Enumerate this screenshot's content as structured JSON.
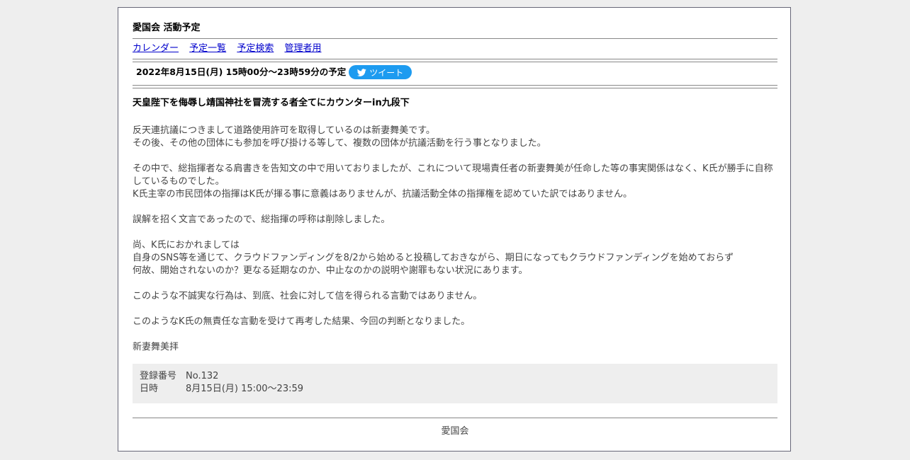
{
  "site": {
    "title": "愛国会 活動予定"
  },
  "nav": {
    "items": [
      "カレンダー",
      "予定一覧",
      "予定検索",
      "管理者用"
    ]
  },
  "schedule": {
    "heading": "2022年8月15日(月) 15時00分～23時59分の予定",
    "tweet_label": "ツイート",
    "tweet_icon": "twitter-bird-icon"
  },
  "event": {
    "title": "天皇陛下を侮辱し靖国神社を冒涜する者全てにカウンターin九段下",
    "body": [
      "反天連抗議につきまして道路使用許可を取得しているのは新妻舞美です。",
      "その後、その他の団体にも参加を呼び掛ける等して、複数の団体が抗議活動を行う事となりました。",
      "",
      "その中で、総指揮者なる肩書きを告知文の中で用いておりましたが、これについて現場責任者の新妻舞美が任命した等の事実関係はなく、K氏が勝手に自称しているものでした。",
      "K氏主宰の市民団体の指揮はK氏が揮る事に意義はありませんが、抗議活動全体の指揮権を認めていた訳ではありません。",
      "",
      "誤解を招く文言であったので、総指揮の呼称は削除しました。",
      "",
      "尚、K氏におかれましては",
      "自身のSNS等を通じて、クラウドファンディングを8/2から始めると投稿しておきながら、期日になってもクラウドファンディングを始めておらず",
      "何故、開始されないのか？更なる延期なのか、中止なのかの説明や謝罪もない状況にあります。",
      "",
      "このような不誠実な行為は、到底、社会に対して信を得られる言動ではありません。",
      "",
      "このようなK氏の無責任な言動を受けて再考した結果、今回の判断となりました。",
      "",
      "新妻舞美拝"
    ]
  },
  "info": {
    "registration_label": "登録番号",
    "registration_value": "No.132",
    "datetime_label": "日時",
    "datetime_value": "8月15日(月) 15:00～23:59"
  },
  "footer": {
    "text": "愛国会"
  },
  "colors": {
    "background": "#eeeeee",
    "link": "#0000cc",
    "tweet_button": "#1d9bf0",
    "info_box": "#eeeeee"
  }
}
